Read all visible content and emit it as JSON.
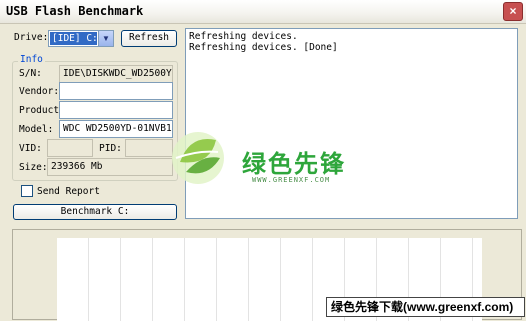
{
  "window": {
    "title": "USB Flash Benchmark",
    "close_label": "×"
  },
  "drive": {
    "label": "Drive:",
    "selected": "[IDE] C:\\",
    "refresh_label": "Refresh"
  },
  "info": {
    "group_title": "Info",
    "sn_label": "S/N:",
    "sn_value": "IDE\\DISKWDC_WD2500YD-01NV",
    "vendor_label": "Vendor:",
    "vendor_value": "",
    "product_label": "Product:",
    "product_value": "",
    "model_label": "Model:",
    "model_value": "WDC WD2500YD-01NVB1",
    "vid_label": "VID:",
    "vid_value": "",
    "pid_label": "PID:",
    "pid_value": "",
    "size_label": "Size:",
    "size_value": "239366 Mb"
  },
  "send_report_label": "Send Report",
  "benchmark_label": "Benchmark C:",
  "log_lines": [
    "Refreshing devices.",
    "Refreshing devices. [Done]"
  ],
  "watermark": {
    "brand": "绿色先锋",
    "url": "WWW.GREENXF.COM"
  },
  "banner": "绿色先锋下载(www.greenxf.com)",
  "colors": {
    "accent_blue": "#316ac5",
    "group_title": "#0046d5",
    "watermark_green": "#2ea63b"
  }
}
